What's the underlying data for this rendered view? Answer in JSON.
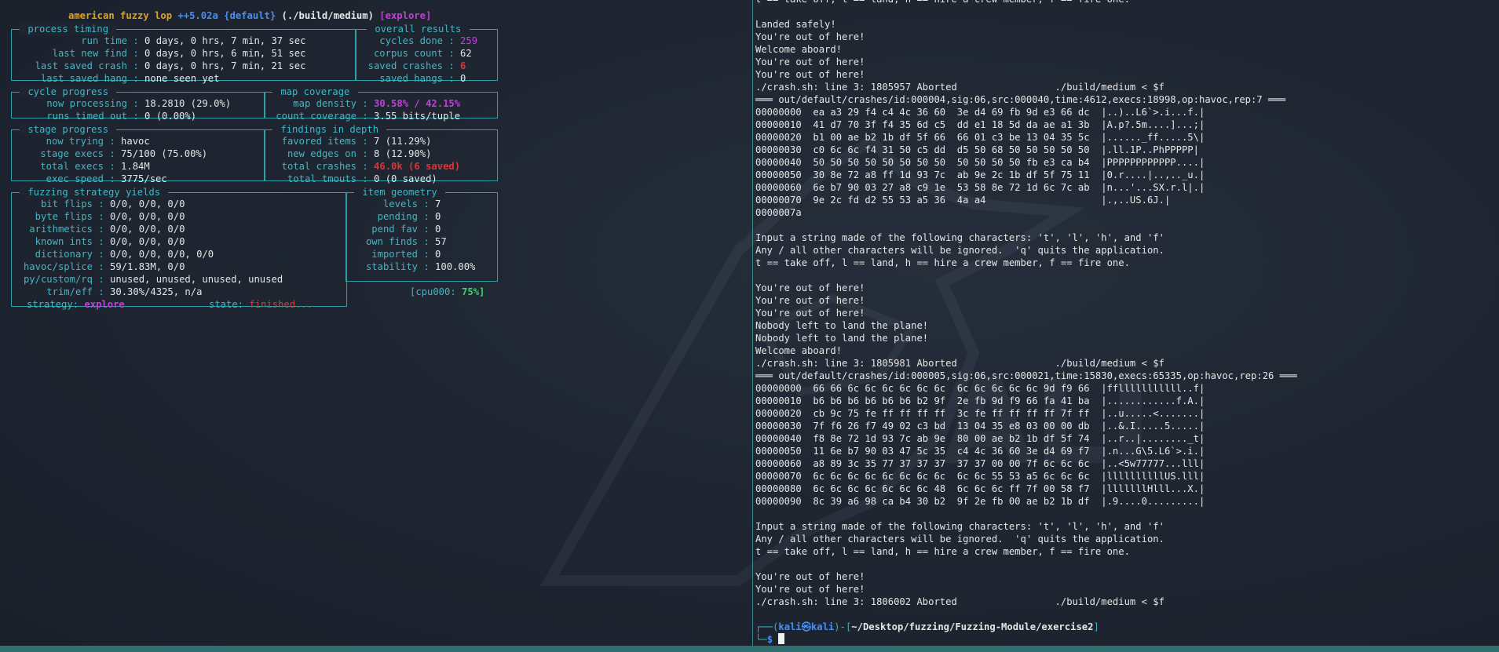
{
  "afl": {
    "title_app": "american fuzzy lop",
    "title_version": "++5.02a",
    "title_group": "{default}",
    "title_target": "(./build/medium)",
    "title_mode": "[explore]",
    "process_timing": {
      "title": " process timing ",
      "rows": [
        {
          "label": "run time",
          "value": "0 days, 0 hrs, 7 min, 37 sec"
        },
        {
          "label": "last new find",
          "value": "0 days, 0 hrs, 6 min, 51 sec"
        },
        {
          "label": "last saved crash",
          "value": "0 days, 0 hrs, 7 min, 21 sec"
        },
        {
          "label": "last saved hang",
          "value": "none seen yet"
        }
      ]
    },
    "overall_results": {
      "title": " overall results ",
      "rows": [
        {
          "label": "cycles done",
          "value": "259"
        },
        {
          "label": "corpus count",
          "value": "62"
        },
        {
          "label": "saved crashes",
          "value": "6"
        },
        {
          "label": "saved hangs",
          "value": "0"
        }
      ]
    },
    "cycle_progress": {
      "title": " cycle progress ",
      "rows": [
        {
          "label": "now processing",
          "value": "18.2810 (29.0%)"
        },
        {
          "label": "runs timed out",
          "value": "0 (0.00%)"
        }
      ]
    },
    "map_coverage": {
      "title": " map coverage ",
      "rows": [
        {
          "label": "map density",
          "value": "30.58% / 42.15%"
        },
        {
          "label": "count coverage",
          "value": "3.55 bits/tuple"
        }
      ]
    },
    "stage_progress": {
      "title": " stage progress ",
      "rows": [
        {
          "label": "now trying",
          "value": "havoc"
        },
        {
          "label": "stage execs",
          "value": "75/100 (75.00%)"
        },
        {
          "label": "total execs",
          "value": "1.84M"
        },
        {
          "label": "exec speed",
          "value": "3775/sec"
        }
      ]
    },
    "findings": {
      "title": " findings in depth ",
      "rows": [
        {
          "label": "favored items",
          "value": "7 (11.29%)"
        },
        {
          "label": "new edges on",
          "value": "8 (12.90%)"
        },
        {
          "label": "total crashes",
          "value": "46.0k (6 saved)"
        },
        {
          "label": "total tmouts",
          "value": "0 (0 saved)"
        }
      ]
    },
    "strategy_yields": {
      "title": " fuzzing strategy yields ",
      "rows": [
        {
          "label": "bit flips",
          "value": "0/0, 0/0, 0/0"
        },
        {
          "label": "byte flips",
          "value": "0/0, 0/0, 0/0"
        },
        {
          "label": "arithmetics",
          "value": "0/0, 0/0, 0/0"
        },
        {
          "label": "known ints",
          "value": "0/0, 0/0, 0/0"
        },
        {
          "label": "dictionary",
          "value": "0/0, 0/0, 0/0, 0/0"
        },
        {
          "label": "havoc/splice",
          "value": "59/1.83M, 0/0"
        },
        {
          "label": "py/custom/rq",
          "value": "unused, unused, unused, unused"
        },
        {
          "label": "trim/eff",
          "value": "30.30%/4325, n/a"
        }
      ]
    },
    "item_geometry": {
      "title": " item geometry ",
      "rows": [
        {
          "label": "levels",
          "value": "7"
        },
        {
          "label": "pending",
          "value": "0"
        },
        {
          "label": "pend fav",
          "value": "0"
        },
        {
          "label": "own finds",
          "value": "57"
        },
        {
          "label": "imported",
          "value": "0"
        },
        {
          "label": "stability",
          "value": "100.00%"
        }
      ]
    },
    "cpu_label": "[cpu000:",
    "cpu_value": "75%]",
    "strategy_label": "strategy:",
    "strategy_value": "explore",
    "state_label": "state:",
    "state_value": "finished..."
  },
  "terminal": {
    "lines": [
      "t == take off, l == land, h == hire a crew member, f == fire one.",
      "",
      "Landed safely!",
      "You're out of here!",
      "Welcome aboard!",
      "You're out of here!",
      "You're out of here!",
      "./crash.sh: line 3: 1805957 Aborted                 ./build/medium < $f",
      "═══ out/default/crashes/id:000004,sig:06,src:000040,time:4612,execs:18998,op:havoc,rep:7 ═══",
      "00000000  ea a3 29 f4 c4 4c 36 60  3e d4 69 fb 9d e3 66 dc  |..)..L6`>.i...f.|",
      "00000010  41 d7 70 3f f4 35 6d c5  dd e1 18 5d da ae a1 3b  |A.p?.5m....]...;|",
      "00000020  b1 00 ae b2 1b df 5f 66  66 01 c3 be 13 04 35 5c  |......_ff.....5\\|",
      "00000030  c0 6c 6c f4 31 50 c5 dd  d5 50 68 50 50 50 50 50  |.ll.1P..PhPPPPP|",
      "00000040  50 50 50 50 50 50 50 50  50 50 50 50 fb e3 ca b4  |PPPPPPPPPPPP....|",
      "00000050  30 8e 72 a8 ff 1d 93 7c  ab 9e 2c 1b df 5f 75 11  |0.r....|..,.._u.|",
      "00000060  6e b7 90 03 27 a8 c9 1e  53 58 8e 72 1d 6c 7c ab  |n...'...SX.r.l|.|",
      "00000070  9e 2c fd d2 55 53 a5 36  4a a4                    |.,..US.6J.|",
      "0000007a",
      "",
      "Input a string made of the following characters: 't', 'l', 'h', and 'f'",
      "Any / all other characters will be ignored.  'q' quits the application.",
      "t == take off, l == land, h == hire a crew member, f == fire one.",
      "",
      "You're out of here!",
      "You're out of here!",
      "You're out of here!",
      "Nobody left to land the plane!",
      "Nobody left to land the plane!",
      "Welcome aboard!",
      "./crash.sh: line 3: 1805981 Aborted                 ./build/medium < $f",
      "═══ out/default/crashes/id:000005,sig:06,src:000021,time:15830,execs:65335,op:havoc,rep:26 ═══",
      "00000000  66 66 6c 6c 6c 6c 6c 6c  6c 6c 6c 6c 6c 9d f9 66  |fflllllllllll..f|",
      "00000010  b6 b6 b6 b6 b6 b6 b2 9f  2e fb 9d f9 66 fa 41 ba  |............f.A.|",
      "00000020  cb 9c 75 fe ff ff ff ff  3c fe ff ff ff ff 7f ff  |..u.....<.......|",
      "00000030  7f f6 26 f7 49 02 c3 bd  13 04 35 e8 03 00 00 db  |..&.I.....5.....|",
      "00000040  f8 8e 72 1d 93 7c ab 9e  80 00 ae b2 1b df 5f 74  |..r..|........_t|",
      "00000050  11 6e b7 90 03 47 5c 35  c4 4c 36 60 3e d4 69 f7  |.n...G\\5.L6`>.i.|",
      "00000060  a8 89 3c 35 77 37 37 37  37 37 00 00 7f 6c 6c 6c  |..<5w77777...lll|",
      "00000070  6c 6c 6c 6c 6c 6c 6c 6c  6c 6c 55 53 a5 6c 6c 6c  |llllllllllUS.lll|",
      "00000080  6c 6c 6c 6c 6c 6c 6c 48  6c 6c 6c ff 7f 00 58 f7  |lllllllHlll...X.|",
      "00000090  8c 39 a6 98 ca b4 30 b2  9f 2e fb 00 ae b2 1b df  |.9....0.........|",
      "",
      "Input a string made of the following characters: 't', 'l', 'h', and 'f'",
      "Any / all other characters will be ignored.  'q' quits the application.",
      "t == take off, l == land, h == hire a crew member, f == fire one.",
      "",
      "You're out of here!",
      "You're out of here!",
      "./crash.sh: line 3: 1806002 Aborted                 ./build/medium < $f",
      ""
    ],
    "prompt": {
      "prefix": "┌──(",
      "user": "kali",
      "at": "㉿",
      "host": "kali",
      "mid": ")-[",
      "path": "~/Desktop/fuzzing/Fuzzing-Module/exercise2",
      "end": "]",
      "second_prefix": "└─",
      "symbol": "$"
    }
  },
  "colors": {
    "accent_cyan": "#3fb8c6",
    "magenta": "#c040d8",
    "red": "#e23232",
    "gold": "#e0a020",
    "prompt_blue": "#4a8ef0"
  }
}
